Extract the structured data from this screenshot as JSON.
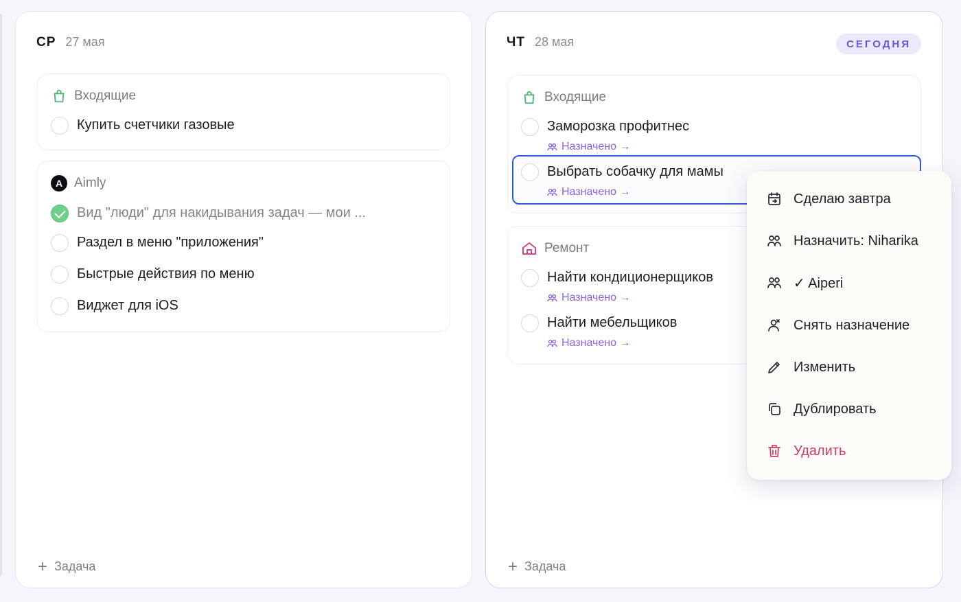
{
  "columns": [
    {
      "day": "СР",
      "date": "27 мая",
      "groups": [
        {
          "title": "Входящие",
          "icon": "bag-icon",
          "tasks": [
            {
              "text": "Купить счетчики газовые",
              "done": false
            }
          ]
        },
        {
          "title": "Aimly",
          "icon": "aimly-avatar",
          "avatar_letter": "A",
          "tasks": [
            {
              "text": "Вид \"люди\" для накидывания задач — мои ...",
              "done": true
            },
            {
              "text": "Раздел в меню \"приложения\"",
              "done": false
            },
            {
              "text": "Быстрые действия по меню",
              "done": false
            },
            {
              "text": "Виджет для iOS",
              "done": false
            }
          ]
        }
      ],
      "add_task_label": "Задача"
    },
    {
      "day": "ЧТ",
      "date": "28 мая",
      "badge": "СЕГОДНЯ",
      "groups": [
        {
          "title": "Входящие",
          "icon": "bag-icon",
          "tasks": [
            {
              "text": "Заморозка профитнес",
              "done": false,
              "assigned": "Назначено →"
            },
            {
              "text": "Выбрать собачку для мамы",
              "done": false,
              "assigned": "Назначено →",
              "selected": true
            }
          ]
        },
        {
          "title": "Ремонт",
          "icon": "home-icon",
          "tasks": [
            {
              "text": "Найти кондиционерщиков",
              "done": false,
              "assigned": "Назначено →"
            },
            {
              "text": "Найти мебельщиков",
              "done": false,
              "assigned": "Назначено →"
            }
          ]
        }
      ],
      "add_task_label": "Задача"
    }
  ],
  "context_menu": {
    "items": [
      {
        "label": "Сделаю завтра",
        "icon": "calendar-forward-icon"
      },
      {
        "label": "Назначить: Niharika",
        "icon": "people-icon"
      },
      {
        "label": "✓ Aiperi",
        "icon": "people-icon"
      },
      {
        "label": "Снять назначение",
        "icon": "person-remove-icon"
      },
      {
        "label": "Изменить",
        "icon": "pencil-icon"
      },
      {
        "label": "Дублировать",
        "icon": "duplicate-icon"
      },
      {
        "label": "Удалить",
        "icon": "trash-icon",
        "danger": true
      }
    ]
  },
  "colors": {
    "accent": "#6b57d6",
    "assigned": "#8a63e4",
    "inbox_icon": "#4cb37a",
    "repair_icon": "#d0487f",
    "selection": "#2f5bd8",
    "danger": "#cc3d6a",
    "done": "#6fcf8b"
  }
}
